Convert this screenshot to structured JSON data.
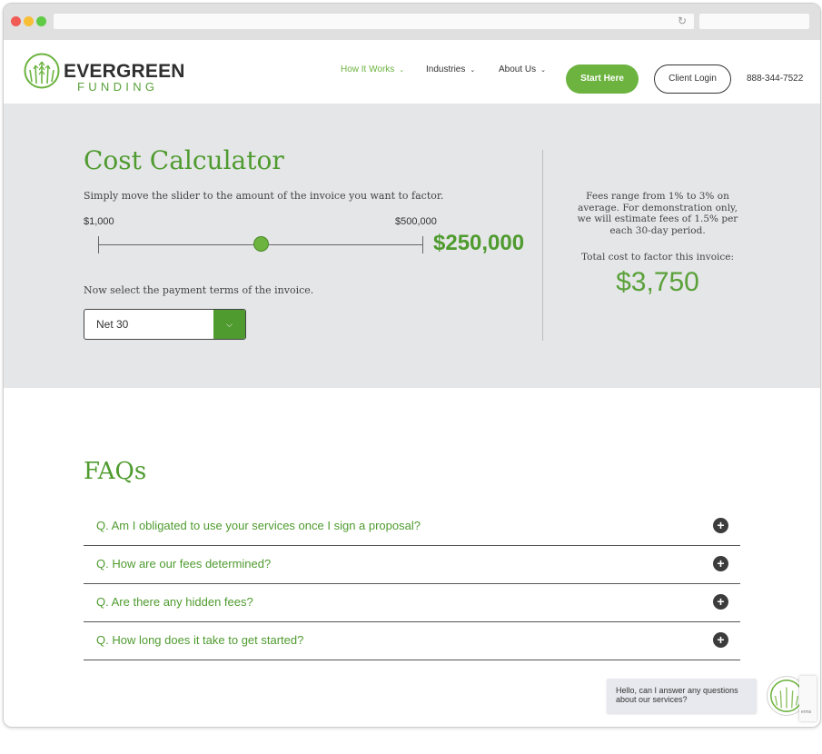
{
  "browser": {
    "colors": {
      "close": "#f15b56",
      "minimize": "#f8be36",
      "maximize": "#5fcb44"
    },
    "reload_icon": "reload-icon"
  },
  "header": {
    "logo": {
      "word1": "EVERGREEN",
      "word2": "FUNDING",
      "icon": "wheat-logo-icon"
    },
    "nav": [
      {
        "label": "How It Works",
        "active": true
      },
      {
        "label": "Industries",
        "active": false
      },
      {
        "label": "About Us",
        "active": false
      }
    ],
    "start_label": "Start Here",
    "login_label": "Client Login",
    "phone": "888-344-7522"
  },
  "calculator": {
    "title": "Cost Calculator",
    "description": "Simply move the slider to the amount of the invoice you want to factor.",
    "slider": {
      "min_label": "$1,000",
      "max_label": "$500,000",
      "value_fraction": 0.5
    },
    "amount": "$250,000",
    "terms_label": "Now select the payment terms of the invoice.",
    "terms_selected": "Net 30",
    "fees_note": "Fees range from 1% to 3% on average. For demonstration only, we will estimate fees of 1.5% per each 30-day period.",
    "total_label": "Total cost to factor this invoice:",
    "total_value": "$3,750"
  },
  "faq": {
    "title": "FAQs",
    "items": [
      {
        "question": "Q. Am I obligated to use your services once I sign a proposal?"
      },
      {
        "question": "Q. How are our fees determined?"
      },
      {
        "question": "Q. Are there any hidden fees?"
      },
      {
        "question": "Q. How long does it take to get started?"
      }
    ]
  },
  "chat": {
    "message": "Hello, can I answer any questions about our services?",
    "recaptcha_text": "erms"
  },
  "theme": {
    "accent": "#6cb33f",
    "accent_dark": "#4f9b2f",
    "band": "#e5e6e8"
  }
}
